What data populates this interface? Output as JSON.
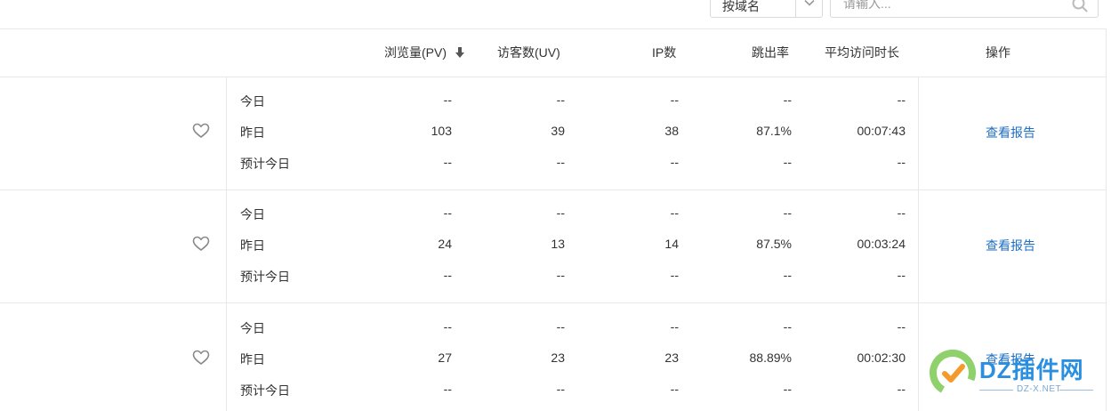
{
  "filter": {
    "select_value": "按域名",
    "search_placeholder": "请输入..."
  },
  "columns": {
    "pv": "浏览量(PV)",
    "uv": "访客数(UV)",
    "ip": "IP数",
    "bounce": "跳出率",
    "avg_time": "平均访问时长",
    "action": "操作"
  },
  "sort_icon": "arrow-down-icon",
  "row_labels": [
    "今日",
    "昨日",
    "预计今日"
  ],
  "sites": [
    {
      "favorite_icon": "heart-icon",
      "report_link": "查看报告",
      "rows": [
        {
          "pv": "--",
          "uv": "--",
          "ip": "--",
          "bounce": "--",
          "avg_time": "--"
        },
        {
          "pv": "103",
          "uv": "39",
          "ip": "38",
          "bounce": "87.1%",
          "avg_time": "00:07:43"
        },
        {
          "pv": "--",
          "uv": "--",
          "ip": "--",
          "bounce": "--",
          "avg_time": "--"
        }
      ]
    },
    {
      "favorite_icon": "heart-icon",
      "report_link": "查看报告",
      "rows": [
        {
          "pv": "--",
          "uv": "--",
          "ip": "--",
          "bounce": "--",
          "avg_time": "--"
        },
        {
          "pv": "24",
          "uv": "13",
          "ip": "14",
          "bounce": "87.5%",
          "avg_time": "00:03:24"
        },
        {
          "pv": "--",
          "uv": "--",
          "ip": "--",
          "bounce": "--",
          "avg_time": "--"
        }
      ]
    },
    {
      "favorite_icon": "heart-icon",
      "report_link": "查看报告",
      "rows": [
        {
          "pv": "--",
          "uv": "--",
          "ip": "--",
          "bounce": "--",
          "avg_time": "--"
        },
        {
          "pv": "27",
          "uv": "23",
          "ip": "23",
          "bounce": "88.89%",
          "avg_time": "00:02:30"
        },
        {
          "pv": "--",
          "uv": "--",
          "ip": "--",
          "bounce": "--",
          "avg_time": "--"
        }
      ]
    }
  ],
  "watermark": {
    "title": "DZ插件网",
    "subtitle": "DZ-X.NET"
  },
  "colors": {
    "link": "#1f6fc5",
    "border": "#e8e8e8",
    "text": "#333333"
  }
}
